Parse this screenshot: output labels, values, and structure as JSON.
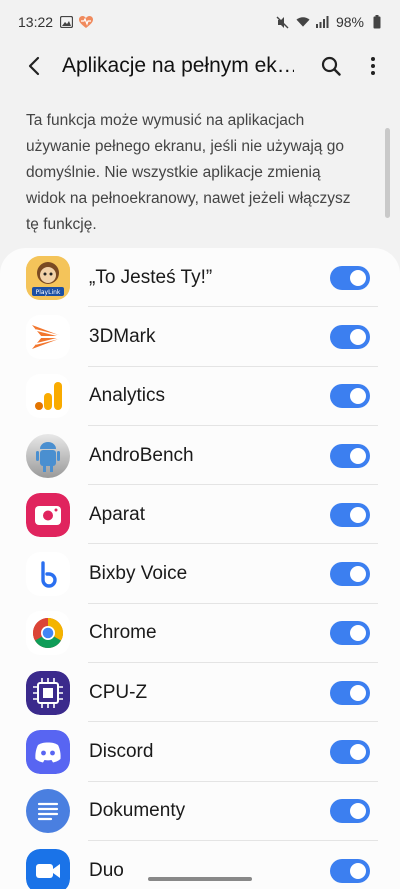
{
  "status_bar": {
    "time": "13:22",
    "battery": "98%",
    "icons_left": [
      "gallery-icon",
      "health-heart-icon"
    ],
    "icons_right": [
      "mute-icon",
      "wifi-icon",
      "signal-icon",
      "battery-icon"
    ]
  },
  "header": {
    "title": "Aplikacje na pełnym ek…"
  },
  "description": "Ta funkcja może wymusić na aplikacjach używanie pełnego ekranu, jeśli nie używają go domyślnie. Nie wszystkie aplikacje zmienią widok na pełnoekranowy, nawet jeżeli włączysz tę funkcję.",
  "accent_color": "#3c7ff0",
  "apps": [
    {
      "name": "„To Jesteś Ty!”",
      "icon": "to-jestes-ty-icon",
      "enabled": true
    },
    {
      "name": "3DMark",
      "icon": "3dmark-icon",
      "enabled": true
    },
    {
      "name": "Analytics",
      "icon": "analytics-icon",
      "enabled": true
    },
    {
      "name": "AndroBench",
      "icon": "androbench-icon",
      "enabled": true
    },
    {
      "name": "Aparat",
      "icon": "camera-icon",
      "enabled": true
    },
    {
      "name": "Bixby Voice",
      "icon": "bixby-icon",
      "enabled": true
    },
    {
      "name": "Chrome",
      "icon": "chrome-icon",
      "enabled": true
    },
    {
      "name": "CPU-Z",
      "icon": "cpu-z-icon",
      "enabled": true
    },
    {
      "name": "Discord",
      "icon": "discord-icon",
      "enabled": true
    },
    {
      "name": "Dokumenty",
      "icon": "docs-icon",
      "enabled": true
    },
    {
      "name": "Duo",
      "icon": "duo-icon",
      "enabled": true
    }
  ]
}
